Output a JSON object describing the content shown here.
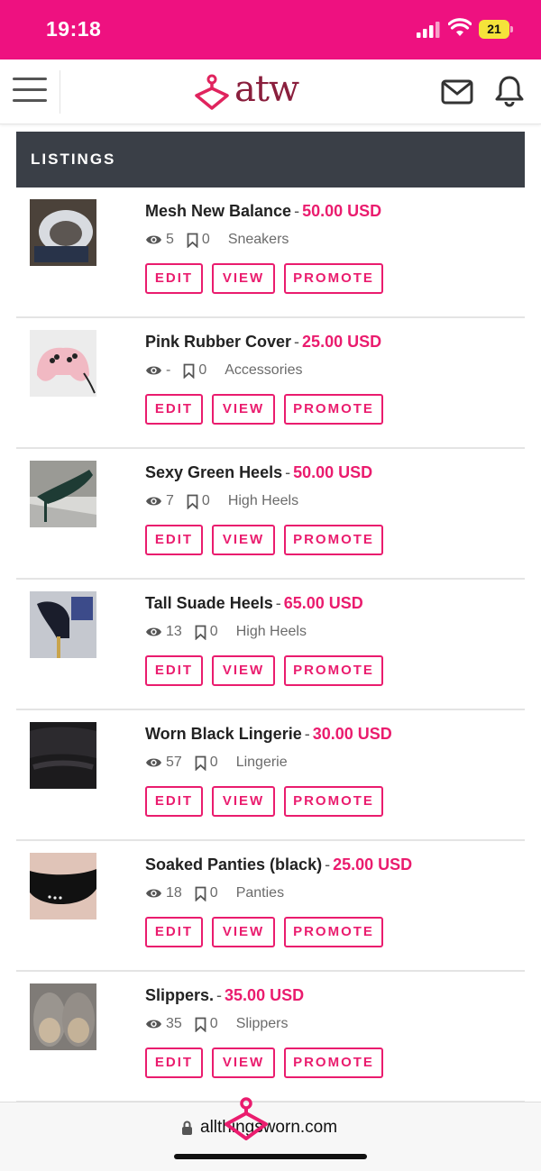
{
  "status_bar": {
    "time": "19:18",
    "battery": "21"
  },
  "header": {
    "logo_text": "atw"
  },
  "section": {
    "title": "LISTINGS"
  },
  "buttons": {
    "edit": "EDIT",
    "view": "VIEW",
    "promote": "PROMOTE"
  },
  "listings": [
    {
      "title": "Mesh New Balance",
      "price": "50.00 USD",
      "views": "5",
      "bookmarks": "0",
      "category": "Sneakers"
    },
    {
      "title": "Pink Rubber Cover",
      "price": "25.00 USD",
      "views": "-",
      "bookmarks": "0",
      "category": "Accessories"
    },
    {
      "title": "Sexy Green Heels",
      "price": "50.00 USD",
      "views": "7",
      "bookmarks": "0",
      "category": "High Heels"
    },
    {
      "title": "Tall Suade Heels",
      "price": "65.00 USD",
      "views": "13",
      "bookmarks": "0",
      "category": "High Heels"
    },
    {
      "title": "Worn Black Lingerie",
      "price": "30.00 USD",
      "views": "57",
      "bookmarks": "0",
      "category": "Lingerie"
    },
    {
      "title": "Soaked Panties (black)",
      "price": "25.00 USD",
      "views": "18",
      "bookmarks": "0",
      "category": "Panties"
    },
    {
      "title": "Slippers.",
      "price": "35.00 USD",
      "views": "35",
      "bookmarks": "0",
      "category": "Slippers"
    }
  ],
  "browser": {
    "url": "allthingsworn.com"
  },
  "colors": {
    "brand_pink": "#ee1180",
    "accent": "#ea1c6e",
    "logo": "#8a1f3d",
    "bar": "#3a3f47"
  }
}
